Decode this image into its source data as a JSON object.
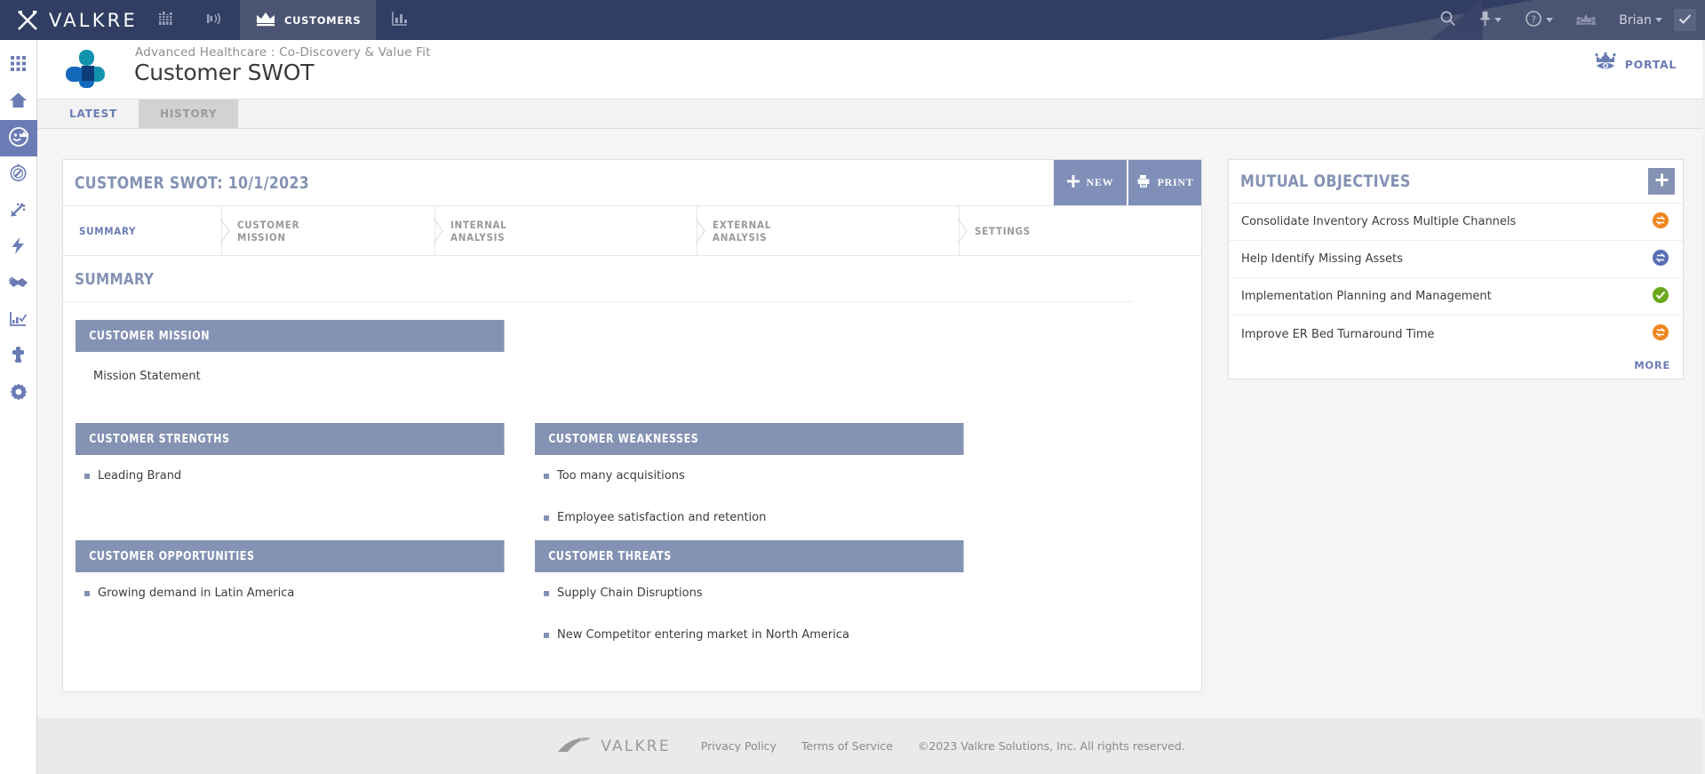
{
  "topbar": {
    "brand": "VALKRE",
    "brand_icon": "crossed-swords-icon",
    "nav": [
      {
        "icon": "bar-columns-icon",
        "label": "",
        "active": false,
        "name": "nav-dashboard"
      },
      {
        "icon": "broadcast-icon",
        "label": "",
        "active": false,
        "name": "nav-broadcast"
      },
      {
        "icon": "crown-icon",
        "label": "CUSTOMERS",
        "active": true,
        "name": "nav-customers"
      },
      {
        "icon": "chart-bar-icon",
        "label": "",
        "active": false,
        "name": "nav-analytics"
      }
    ],
    "right": {
      "search_icon": "search-icon",
      "pin_icon": "pin-icon",
      "help_icon": "question-circle-icon",
      "crown_group_icon": "crown-group-icon",
      "user_name": "Brian",
      "check_icon": "check-icon"
    }
  },
  "rail": {
    "items": [
      {
        "name": "rail-apps",
        "icon": "grid-apps-icon",
        "active": false
      },
      {
        "name": "rail-home",
        "icon": "home-icon",
        "active": false
      },
      {
        "name": "rail-customers",
        "icon": "customer-face-crown-icon",
        "active": true
      },
      {
        "name": "rail-discover",
        "icon": "compass-icon",
        "active": false
      },
      {
        "name": "rail-launch",
        "icon": "arrow-launch-icon",
        "active": false
      },
      {
        "name": "rail-energy",
        "icon": "lightning-bolt-icon",
        "active": false
      },
      {
        "name": "rail-partnership",
        "icon": "handshake-icon",
        "active": false
      },
      {
        "name": "rail-reports",
        "icon": "chart-check-icon",
        "active": false
      },
      {
        "name": "rail-integrations",
        "icon": "puzzle-piece-icon",
        "active": false
      },
      {
        "name": "rail-settings",
        "icon": "gear-icon",
        "active": false
      }
    ]
  },
  "page_header": {
    "logo_icon": "healthcare-cross-logo",
    "breadcrumb": "Advanced Healthcare : Co-Discovery & Value Fit",
    "title": "Customer SWOT",
    "portal_label": "PORTAL",
    "portal_icon": "crown-eye-icon"
  },
  "tabs": [
    {
      "label": "LATEST",
      "active": true,
      "name": "tab-latest"
    },
    {
      "label": "HISTORY",
      "active": false,
      "name": "tab-history"
    }
  ],
  "main": {
    "card_title": "CUSTOMER SWOT: 10/1/2023",
    "buttons": [
      {
        "label": "NEW",
        "icon": "plus-icon",
        "name": "new-button"
      },
      {
        "label": "PRINT",
        "icon": "printer-icon",
        "name": "print-button"
      }
    ],
    "subtabs": [
      {
        "label": "SUMMARY",
        "line2": "",
        "active": true,
        "name": "subtab-summary"
      },
      {
        "label": "CUSTOMER",
        "line2": "MISSION",
        "active": false,
        "name": "subtab-customer-mission"
      },
      {
        "label": "INTERNAL",
        "line2": "ANALYSIS",
        "active": false,
        "name": "subtab-internal-analysis"
      },
      {
        "label": "EXTERNAL",
        "line2": "ANALYSIS",
        "active": false,
        "name": "subtab-external-analysis"
      },
      {
        "label": "SETTINGS",
        "line2": "",
        "active": false,
        "name": "subtab-settings"
      }
    ],
    "section_title": "SUMMARY",
    "mission": {
      "header": "CUSTOMER MISSION",
      "statement": "Mission Statement"
    },
    "strengths": {
      "header": "CUSTOMER STRENGTHS",
      "items": [
        "Leading Brand"
      ]
    },
    "weaknesses": {
      "header": "CUSTOMER WEAKNESSES",
      "items": [
        "Too many acquisitions",
        "Employee satisfaction and retention"
      ]
    },
    "opportunities": {
      "header": "CUSTOMER OPPORTUNITIES",
      "items": [
        "Growing demand in Latin America"
      ]
    },
    "threats": {
      "header": "CUSTOMER THREATS",
      "items": [
        "Supply Chain Disruptions",
        "New Competitor entering market in North America"
      ]
    }
  },
  "side": {
    "title": "MUTUAL OBJECTIVES",
    "add_icon": "plus-icon",
    "objectives": [
      {
        "label": "Consolidate Inventory Across Multiple Channels",
        "status": "in-progress-orange",
        "status_icon": "recycle-icon"
      },
      {
        "label": "Help Identify Missing Assets",
        "status": "in-progress-blue",
        "status_icon": "recycle-icon"
      },
      {
        "label": "Implementation Planning and Management",
        "status": "complete-green",
        "status_icon": "check-circle-icon"
      },
      {
        "label": "Improve ER Bed Turnaround Time",
        "status": "in-progress-orange",
        "status_icon": "recycle-icon"
      }
    ],
    "more_label": "MORE"
  },
  "footer": {
    "logo_text": "VALKRE",
    "logo_icon": "valkre-swoosh-icon",
    "links": [
      "Privacy Policy",
      "Terms of Service"
    ],
    "copyright": "©2023 Valkre Solutions, Inc. All rights reserved."
  },
  "colors": {
    "topbar_bg": "#313e63",
    "accent_blue": "#6b7cb5",
    "panel_header": "#8492b4",
    "status_orange": "#f0871f",
    "status_blue": "#5b6fb5",
    "status_green": "#6aa91e"
  }
}
